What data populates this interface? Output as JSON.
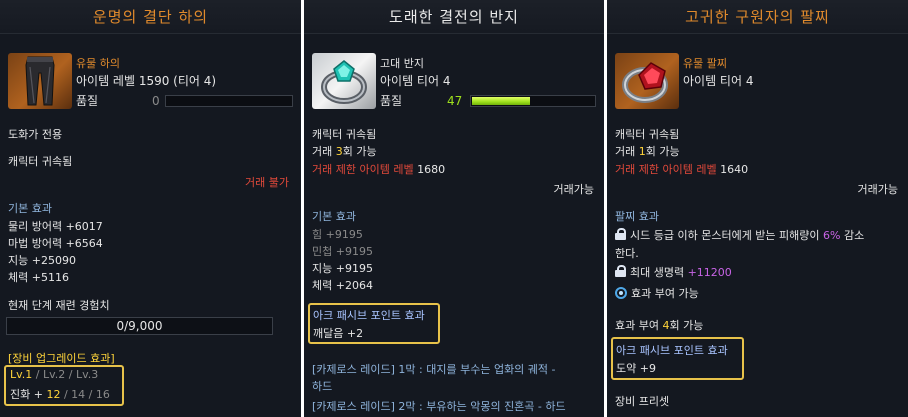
{
  "panel1": {
    "title": "운명의 결단 하의",
    "grade": "유물 하의",
    "item_level": "아이템 레벨 1590 (티어 4)",
    "quality_label": "품질",
    "quality_value": "0",
    "quality_fraction": 0,
    "class_only": "도화가 전용",
    "bound": "캐릭터 귀속됨",
    "trade": "거래 불가",
    "base_effect_label": "기본 효과",
    "stats": [
      "물리 방어력 +6017",
      "마법 방어력 +6564",
      "지능 +25090",
      "체력 +5116"
    ],
    "exp_label": "현재 단계 재련 경험치",
    "exp_value": "0/9,000",
    "upgrade_label": "[장비 업그레이드 효과]",
    "lv_current": "Lv.1",
    "lv_sep1": " / ",
    "lv_next1": "Lv.2",
    "lv_sep2": " / ",
    "lv_next2": "Lv.3",
    "evo_prefix": "진화 + ",
    "evo_current": "12",
    "evo_sep1": " / ",
    "evo_next1": "14",
    "evo_sep2": " / ",
    "evo_next2": "16"
  },
  "panel2": {
    "title": "도래한 결전의 반지",
    "grade": "고대 반지",
    "item_tier": "아이템 티어 4",
    "quality_label": "품질",
    "quality_value": "47",
    "quality_fraction": 0.47,
    "bound": "캐릭터 귀속됨",
    "trade_count_prefix": "거래 ",
    "trade_count": "3",
    "trade_count_suffix": "회 가능",
    "trade_level_label": "거래 제한 아이템 레벨",
    "trade_level_value": " 1680",
    "tradeable": "거래가능",
    "base_effect_label": "기본 효과",
    "stats_dim": [
      "힘 +9195",
      "민첩 +9195"
    ],
    "stats": [
      "지능 +9195",
      "체력 +2064"
    ],
    "ark_label": "아크 패시브 포인트 효과",
    "ark_value": "깨달음 +2",
    "raid1_line1": "[카제로스 레이드] 1막 : 대지를 부수는 업화의 궤적 -",
    "raid1_line2": "하드",
    "raid2_line1": "[카제로스 레이드] 2막 : 부유하는 악몽의 진혼곡 - 하드"
  },
  "panel3": {
    "title": "고귀한 구원자의 팔찌",
    "grade": "유물 팔찌",
    "item_tier": "아이템 티어 4",
    "bound": "캐릭터 귀속됨",
    "trade_count_prefix": "거래 ",
    "trade_count": "1",
    "trade_count_suffix": "회 가능",
    "trade_level_label": "거래 제한 아이템 레벨",
    "trade_level_value": " 1640",
    "tradeable": "거래가능",
    "bracelet_effect_label": "팔찌 효과",
    "effect1_prefix": "시드 등급 이하 몬스터에게 받는 피해량이 ",
    "effect1_value": "6%",
    "effect1_suffix": " 감소",
    "effect1_line2": "한다.",
    "effect2_prefix": "최대 생명력 ",
    "effect2_value": "+11200",
    "effect3": "효과 부여 가능",
    "grant_prefix": "효과 부여 ",
    "grant_count": "4",
    "grant_suffix": "회 가능",
    "ark_label": "아크 패시브 포인트 효과",
    "ark_value": "도약 +9",
    "preset": "장비 프리셋"
  },
  "colors": {
    "relic_orange": "#e08a2c",
    "ancient_white": "#e9e9e9",
    "restriction_red": "#e2493a",
    "highlight_yellow": "#ffd43a",
    "section_blue": "#8fb4dc",
    "quality_green": "#9ee01c",
    "percent_purple": "#c864e6",
    "box_gold": "#e7c24a"
  },
  "icons": [
    "pants-item-icon",
    "ring-item-icon",
    "bracelet-item-icon",
    "lock-icon",
    "swirl-icon"
  ]
}
